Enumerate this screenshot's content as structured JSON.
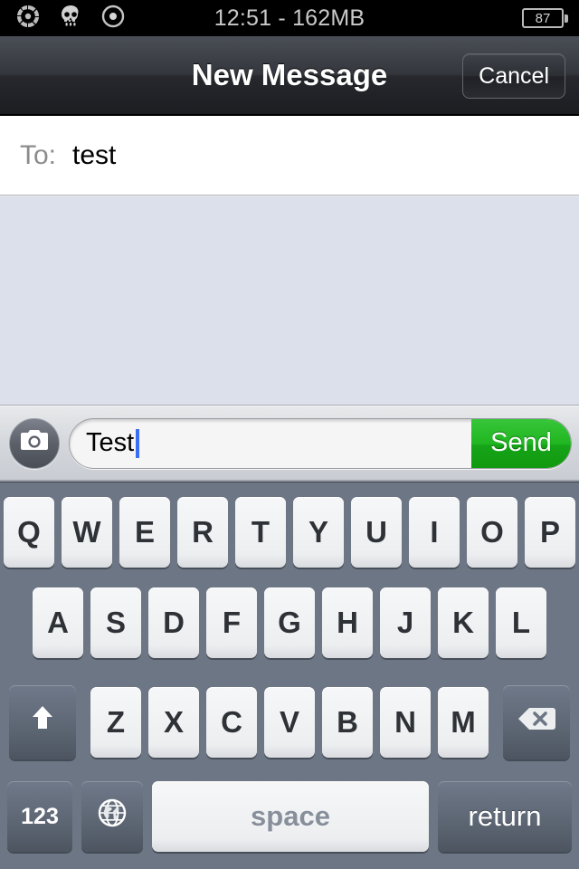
{
  "status_bar": {
    "icons": [
      "segmented-circle-icon",
      "skull-icon",
      "target-circle-icon"
    ],
    "center_text": "12:51 - 162MB",
    "battery_level": "87"
  },
  "nav_bar": {
    "title": "New Message",
    "cancel_label": "Cancel"
  },
  "recipient": {
    "label": "To:",
    "value": "test"
  },
  "input_toolbar": {
    "camera_icon": "camera-icon",
    "message_text": "Test",
    "message_placeholder": "",
    "send_label": "Send",
    "send_color": "#1fb520",
    "caret_color": "#3b6ef0"
  },
  "keyboard": {
    "row1": [
      "Q",
      "W",
      "E",
      "R",
      "T",
      "Y",
      "U",
      "I",
      "O",
      "P"
    ],
    "row2": [
      "A",
      "S",
      "D",
      "F",
      "G",
      "H",
      "J",
      "K",
      "L"
    ],
    "row3": [
      "Z",
      "X",
      "C",
      "V",
      "B",
      "N",
      "M"
    ],
    "shift_icon": "shift-arrow-icon",
    "backspace_icon": "backspace-icon",
    "numbers_label": "123",
    "globe_icon": "globe-icon",
    "space_label": "space",
    "return_label": "return",
    "background_color": "#6d7684",
    "key_color": "#eceef0"
  }
}
